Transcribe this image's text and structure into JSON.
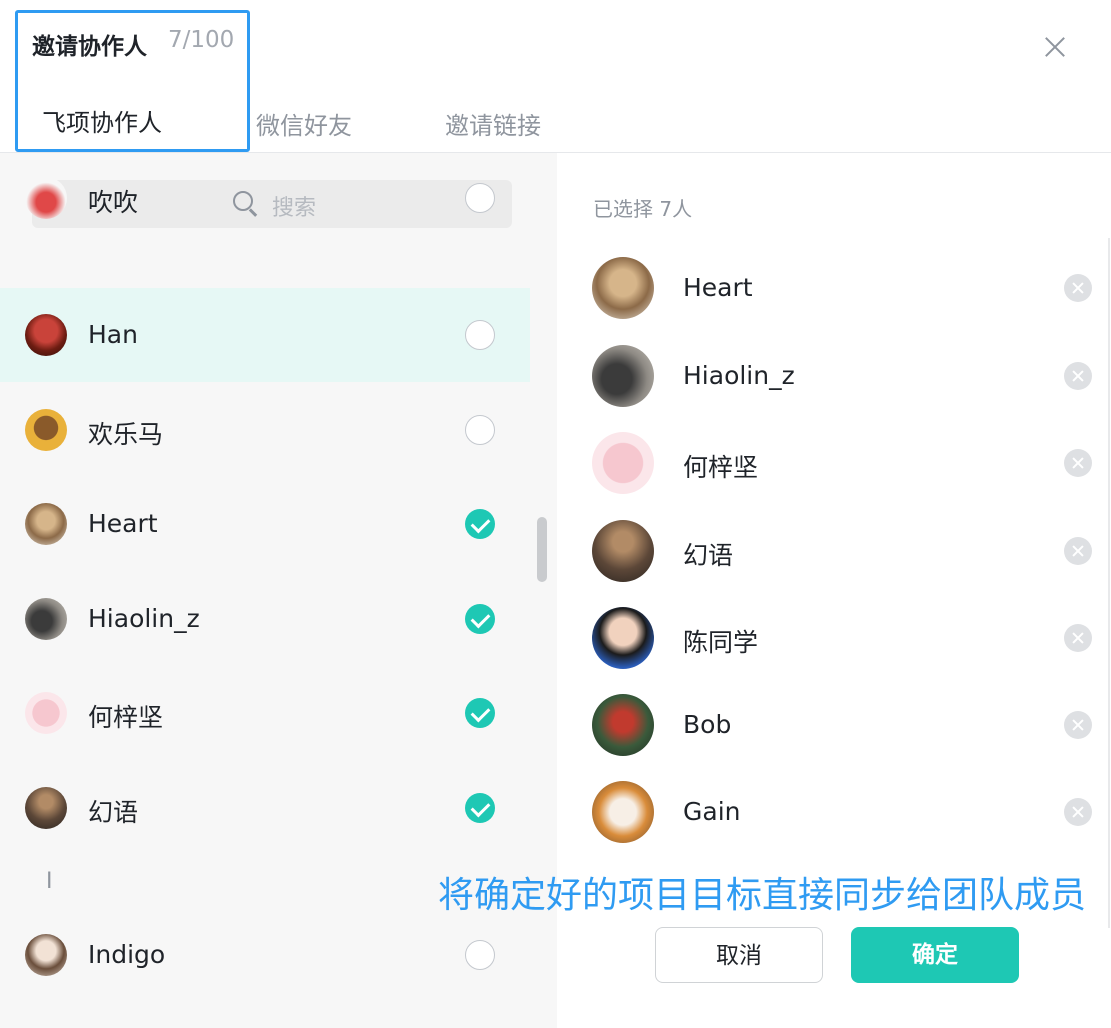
{
  "header": {
    "title": "邀请协作人",
    "count": "7/100",
    "tabs": [
      {
        "label": "飞项协作人"
      },
      {
        "label": "微信好友"
      },
      {
        "label": "邀请链接"
      }
    ]
  },
  "search": {
    "placeholder": "搜索"
  },
  "contacts": [
    {
      "name": "吹吹",
      "checked": false,
      "avatar": "avatar-partial"
    },
    {
      "name": "Han",
      "checked": false,
      "avatar": "avatar"
    },
    {
      "name": "欢乐马",
      "checked": false,
      "avatar": "avatar"
    },
    {
      "name": "Heart",
      "checked": true,
      "avatar": "avatar"
    },
    {
      "name": "Hiaolin_z",
      "checked": true,
      "avatar": "avatar"
    },
    {
      "name": "何梓坚",
      "checked": true,
      "avatar": "avatar"
    },
    {
      "name": "幻语",
      "checked": true,
      "avatar": "avatar"
    },
    {
      "name": "Indigo",
      "checked": false,
      "avatar": "avatar"
    }
  ],
  "index_letter": "I",
  "selected": {
    "title": "已选择 7人",
    "items": [
      {
        "name": "Heart"
      },
      {
        "name": "Hiaolin_z"
      },
      {
        "name": "何梓坚"
      },
      {
        "name": "幻语"
      },
      {
        "name": "陈同学"
      },
      {
        "name": "Bob"
      },
      {
        "name": "Gain"
      }
    ]
  },
  "caption": "将确定好的项目目标直接同步给团队成员",
  "buttons": {
    "cancel": "取消",
    "confirm": "确定"
  },
  "colors": {
    "accent": "#1ec8b4",
    "highlight": "#2f9bf2",
    "hover_row": "#e6f8f5"
  }
}
